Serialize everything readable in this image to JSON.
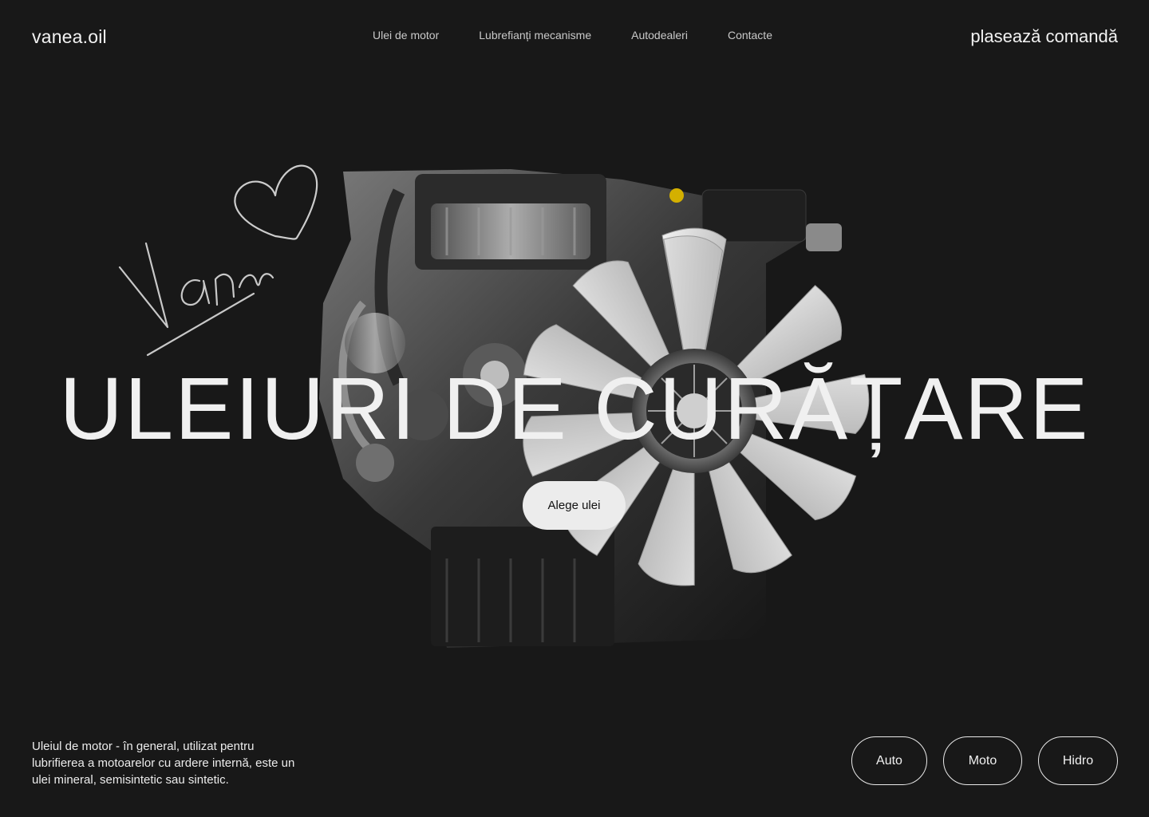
{
  "header": {
    "logo": "vanea.oil",
    "nav": [
      {
        "label": "Ulei de motor"
      },
      {
        "label": "Lubrefianți mecanisme"
      },
      {
        "label": "Autodealeri"
      },
      {
        "label": "Contacte"
      }
    ],
    "order_label": "plasează comandă"
  },
  "hero": {
    "title": "ULEIURI DE CURĂȚARE",
    "cta_label": "Alege ulei",
    "image": "engine-with-fan",
    "signature": "Vanea"
  },
  "footer": {
    "description": "Uleiul de motor - în general, utilizat pentru lubrifierea a motoarelor cu ardere internă, este un ulei mineral, semisintetic sau sintetic.",
    "categories": [
      {
        "label": "Auto"
      },
      {
        "label": "Moto"
      },
      {
        "label": "Hidro"
      }
    ]
  },
  "colors": {
    "background": "#181818",
    "text": "#f2f2f2",
    "button_bg": "#ececec"
  }
}
